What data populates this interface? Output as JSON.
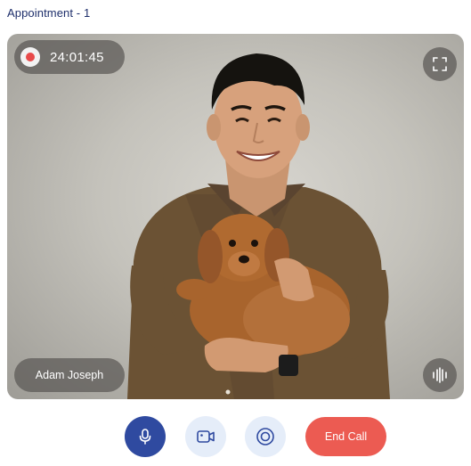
{
  "page": {
    "title": "Appointment - 1"
  },
  "video": {
    "participant_name": "Adam Joseph",
    "recording": {
      "timer": "24:01:45",
      "icon": "record-dot-icon",
      "color": "#e84a4a"
    },
    "fullscreen_icon": "fullscreen-icon",
    "audio_icon": "audio-waveform-icon"
  },
  "controls": {
    "mic_icon": "microphone-icon",
    "camera_icon": "video-camera-icon",
    "record_icon": "record-icon",
    "end_call_label": "End Call",
    "colors": {
      "mic_active": "#2f4aa0",
      "secondary": "#e5edf9",
      "end_call": "#ec5b52"
    }
  }
}
